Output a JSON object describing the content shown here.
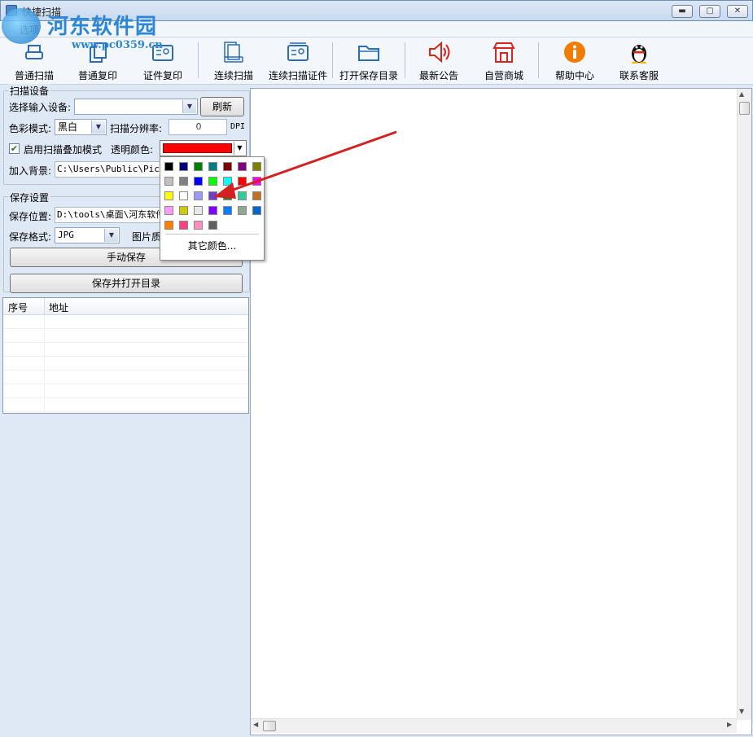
{
  "window": {
    "title": "快捷扫描",
    "menu_item": "选项",
    "controls": {
      "minimize": "▬",
      "maximize": "▢",
      "close": "✕"
    }
  },
  "watermark": {
    "title": "河东软件园",
    "url": "www.pc0359.cn"
  },
  "toolbar": {
    "items": [
      {
        "label": "普通扫描",
        "icon": "scanner-icon"
      },
      {
        "label": "普通复印",
        "icon": "copy-icon"
      },
      {
        "label": "证件复印",
        "icon": "id-card-icon"
      },
      {
        "label": "连续扫描",
        "icon": "continuous-scan-icon"
      },
      {
        "label": "连续扫描证件",
        "icon": "continuous-id-scan-icon"
      },
      {
        "label": "打开保存目录",
        "icon": "folder-icon"
      },
      {
        "label": "最新公告",
        "icon": "speaker-icon"
      },
      {
        "label": "自营商城",
        "icon": "store-icon"
      },
      {
        "label": "帮助中心",
        "icon": "info-icon"
      },
      {
        "label": "联系客服",
        "icon": "qq-penguin-icon"
      }
    ]
  },
  "scan_settings": {
    "group_label": "扫描设备",
    "device_label": "选择输入设备:",
    "device_value": "",
    "refresh_label": "刷新",
    "color_mode_label": "色彩模式:",
    "color_mode_value": "黑白",
    "resolution_label": "扫描分辨率:",
    "resolution_value": "0",
    "resolution_unit": "DPI",
    "overlay_label": "启用扫描叠加模式",
    "overlay_checked": true,
    "transparent_label": "透明颜色:",
    "transparent_color": "#ff0000",
    "background_label": "加入背景:",
    "background_value": "C:\\Users\\Public\\Pictu"
  },
  "save_settings": {
    "group_label": "保存设置",
    "location_label": "保存位置:",
    "location_value": "D:\\tools\\桌面\\河东软件",
    "format_label": "保存格式:",
    "format_value": "JPG",
    "quality_label": "图片质",
    "manual_save_label": "手动保存",
    "save_open_label": "保存并打开目录"
  },
  "file_list": {
    "columns": [
      "序号",
      "地址"
    ],
    "rows": [
      [
        "",
        ""
      ],
      [
        "",
        ""
      ],
      [
        "",
        ""
      ],
      [
        "",
        ""
      ],
      [
        "",
        ""
      ],
      [
        "",
        ""
      ],
      [
        "",
        ""
      ]
    ]
  },
  "color_picker": {
    "swatches": [
      "#000000",
      "#000080",
      "#008000",
      "#008080",
      "#800000",
      "#800080",
      "#808000",
      "#c0c0c0",
      "#808080",
      "#0000ff",
      "#00ff00",
      "#00ffff",
      "#ff0000",
      "#ff00ff",
      "#ffff00",
      "#ffffff",
      "#9999ff",
      "#6a40c8",
      "#3f7d1e",
      "#33cc99",
      "#c07020",
      "#ff99ff",
      "#cccc00",
      "#e8e8e8",
      "#8000ff",
      "#0080ff",
      "#8fa88f",
      "#0066cc",
      "#ff8000",
      "#ff4080",
      "#ff8fbf",
      "#606060"
    ],
    "more_label": "其它颜色..."
  },
  "colors": {
    "accent": "#2c86d6",
    "annotation_arrow": "#d42020"
  }
}
